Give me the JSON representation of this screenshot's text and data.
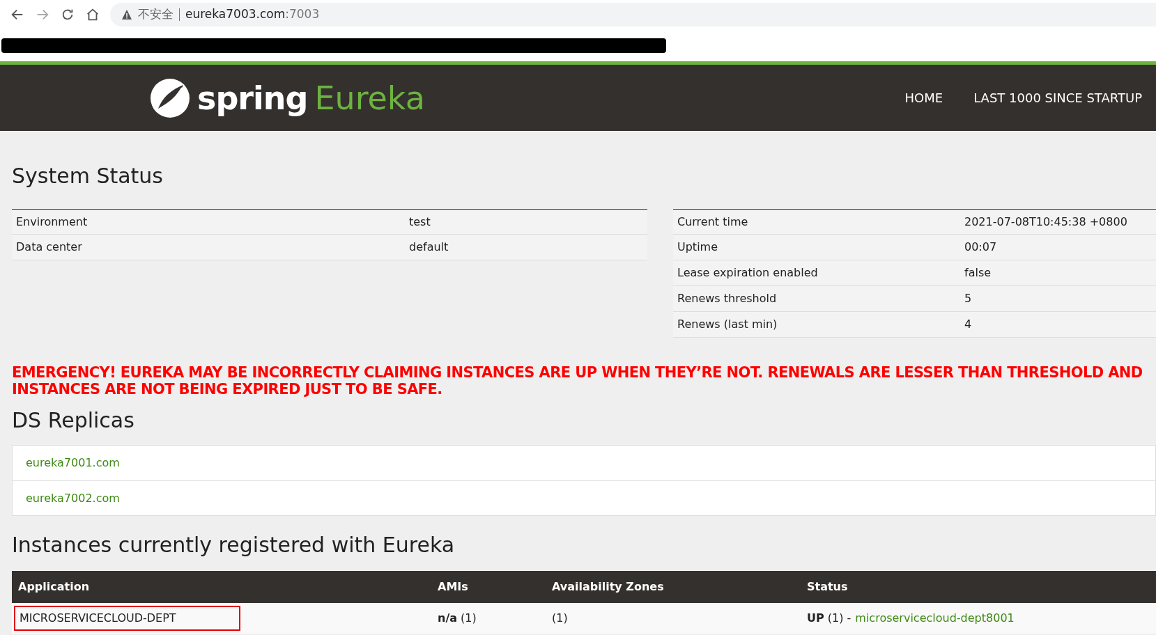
{
  "browser": {
    "security_label": "不安全",
    "url_host": "eureka7003.com",
    "url_port": ":7003"
  },
  "header": {
    "brand_word": "spring",
    "product_word": "Eureka",
    "nav": [
      {
        "label": "HOME"
      },
      {
        "label": "LAST 1000 SINCE STARTUP"
      }
    ]
  },
  "system_status": {
    "title": "System Status",
    "left": [
      {
        "name": "Environment",
        "value": "test"
      },
      {
        "name": "Data center",
        "value": "default"
      }
    ],
    "right": [
      {
        "name": "Current time",
        "value": "2021-07-08T10:45:38 +0800"
      },
      {
        "name": "Uptime",
        "value": "00:07"
      },
      {
        "name": "Lease expiration enabled",
        "value": "false"
      },
      {
        "name": "Renews threshold",
        "value": "5"
      },
      {
        "name": "Renews (last min)",
        "value": "4"
      }
    ]
  },
  "emergency": [
    "EMERGENCY! EUREKA MAY BE INCORRECTLY CLAIMING INSTANCES ARE UP WHEN THEY’RE NOT. RENEWALS ARE LESSER THAN THRESHOLD AND",
    "INSTANCES ARE NOT BEING EXPIRED JUST TO BE SAFE."
  ],
  "ds_replicas": {
    "title": "DS Replicas",
    "items": [
      "eureka7001.com",
      "eureka7002.com"
    ]
  },
  "instances": {
    "title": "Instances currently registered with Eureka",
    "columns": [
      "Application",
      "AMIs",
      "Availability Zones",
      "Status"
    ],
    "rows": [
      {
        "application": "MICROSERVICECLOUD-DEPT",
        "outlined": true,
        "amis": "**n/a** (1)",
        "zones": "(1)",
        "status": "**UP** (1) -",
        "instance_link": "microservicecloud-dept8001"
      }
    ]
  }
}
